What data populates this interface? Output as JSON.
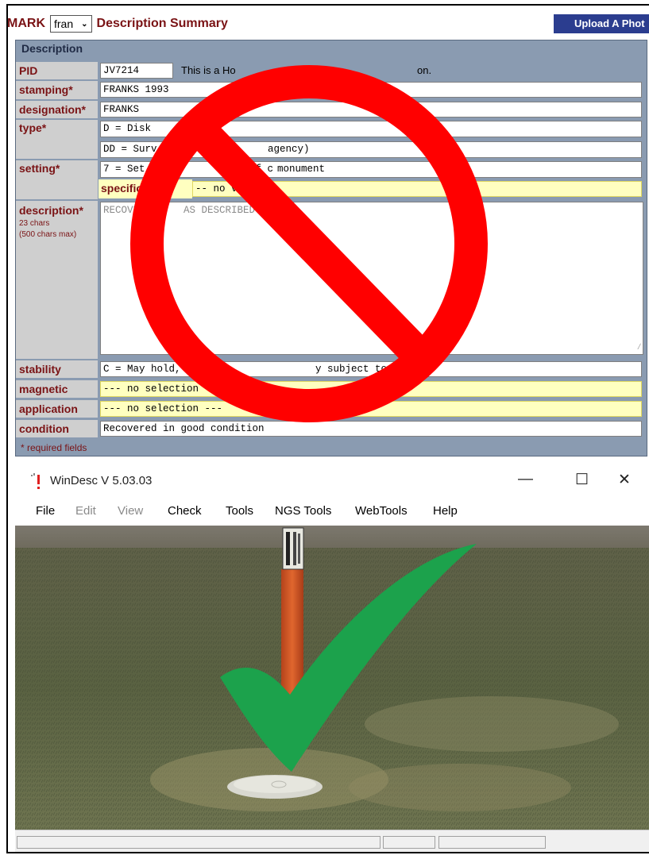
{
  "header": {
    "mark_label": "MARK",
    "mark_select": "fran",
    "title": "Description Summary",
    "upload_button": "Upload A Phot"
  },
  "panel": {
    "title": "Description",
    "rows": {
      "pid": {
        "label": "PID",
        "value": "JV7214",
        "note": "This is a Ho",
        "note_tail": "on."
      },
      "stamping": {
        "label": "stamping*",
        "value": "FRANKS 1993"
      },
      "designation": {
        "label": "designation*",
        "value": "FRANKS"
      },
      "type": {
        "label": "type*",
        "value": "D = Disk",
        "value2": "DD = Surv",
        "value2_mid": "sk",
        "value2_tail": "agency)"
      },
      "setting": {
        "label": "setting*",
        "value": "7 = Set",
        "value_mid": "p of c",
        "value_tail": "monument",
        "specific_label": "specific",
        "specific_value": "-- no va"
      },
      "description": {
        "label": "description*",
        "chars": "23 chars",
        "max": "(500 chars max)",
        "value": "RECOVE",
        "value_tail": "AS DESCRIBED"
      },
      "stability": {
        "label": "stability",
        "value": "C = May hold,",
        "value_tail": "y subject to ground"
      },
      "magnetic": {
        "label": "magnetic",
        "value": "--- no selection"
      },
      "application": {
        "label": "application",
        "value": "--- no selection ---"
      },
      "condition": {
        "label": "condition",
        "value": "Recovered in good condition"
      }
    },
    "required_note": "* required fields"
  },
  "windesc": {
    "title": "WinDesc V 5.03.03",
    "controls": {
      "minimize": "—",
      "maximize": "☐",
      "close": "✕"
    },
    "menu": [
      "File",
      "Edit",
      "View",
      "Check",
      "Tools",
      "NGS Tools",
      "WebTools",
      "Help"
    ],
    "menu_disabled": [
      false,
      true,
      true,
      false,
      false,
      false,
      false,
      false
    ]
  },
  "colors": {
    "label_text": "#7a1315",
    "panel_bg": "#8a9bb1",
    "upload_bg": "#2b3d8f",
    "no_symbol": "#ff0000",
    "checkmark": "#1ca24c"
  },
  "icons": [
    "chevron-down-icon",
    "windesc-app-icon",
    "no-symbol-icon",
    "checkmark-icon"
  ]
}
